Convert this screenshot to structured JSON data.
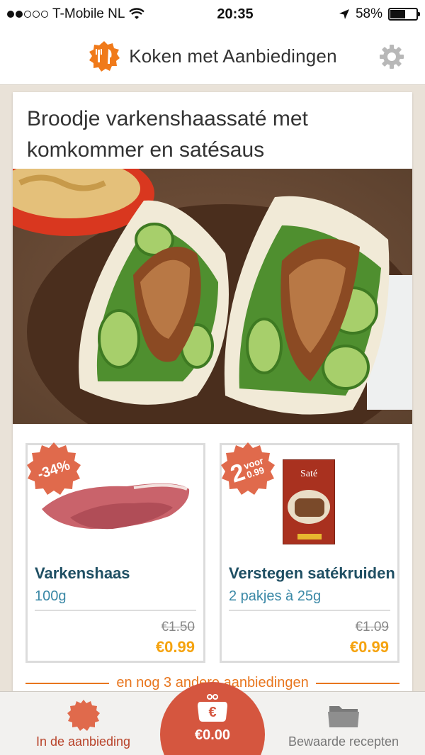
{
  "status": {
    "carrier": "T-Mobile NL",
    "time": "20:35",
    "battery": "58%",
    "battery_level": 0.58
  },
  "header": {
    "title": "Koken met Aanbiedingen",
    "icons": [
      "chef-logo-icon",
      "gear-icon"
    ]
  },
  "recipe": {
    "title": "Broodje varkenshaassaté met komkommer en satésaus"
  },
  "offers": [
    {
      "badge": "-34%",
      "name": "Varkenshaas",
      "quantity": "100g",
      "old_price": "€1.50",
      "new_price": "€0.99"
    },
    {
      "badge_top": "2",
      "badge_voor": "voor",
      "badge_price": "0.99",
      "name": "Verstegen satékruiden",
      "quantity": "2 pakjes à 25g",
      "old_price": "€1.09",
      "new_price": "€0.99",
      "package_label": "Saté"
    }
  ],
  "more_offers": "en nog 3 andere aanbiedingen",
  "tabbar": {
    "left_label": "In de aanbieding",
    "center_label": "€0.00",
    "right_label": "Bewaarde recepten"
  },
  "colors": {
    "accent_orange": "#e8761e",
    "badge_red": "#e06a4c",
    "price_yellow": "#f5a30f",
    "name_blue": "#1f4f63",
    "qty_blue": "#3a88a6"
  }
}
